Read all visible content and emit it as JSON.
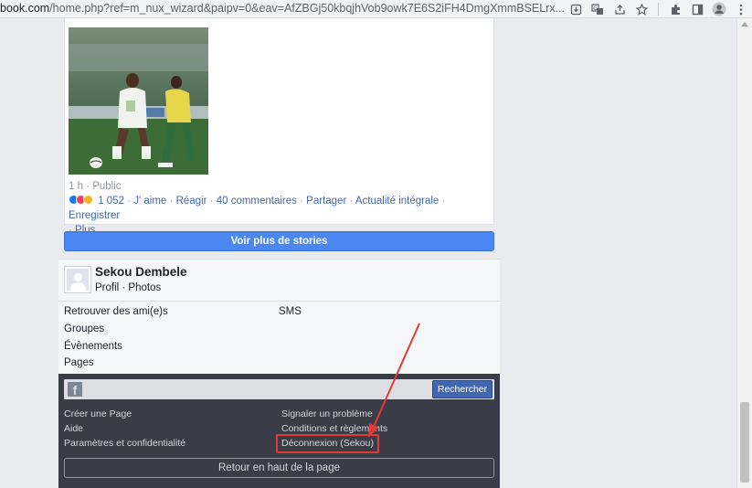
{
  "browser": {
    "url_host": "book.com",
    "url_rest": "/home.php?ref=m_nux_wizard&paipv=0&eav=AfZBGj50kbqjhVob9owk7E6S2iFH4DmgXmmBSELrx..."
  },
  "post": {
    "meta": "1 h · Public",
    "reaction_count": "1 052",
    "actions": [
      "J' aime",
      "Réagir",
      "40 commentaires",
      "Partager",
      "Actualité intégrale",
      "Enregistrer",
      "Plus"
    ]
  },
  "more_stories": "Voir plus de stories",
  "profile": {
    "name": "Sekou Dembele",
    "links": "Profil · Photos"
  },
  "links": {
    "friends": "Retrouver des ami(e)s",
    "sms": "SMS",
    "groups": "Groupes",
    "events": "Évènements",
    "pages": "Pages"
  },
  "footer": {
    "logo": "f",
    "search_button": "Rechercher",
    "create_page": "Créer une Page",
    "report": "Signaler un problème",
    "help": "Aide",
    "terms": "Conditions et règlements",
    "privacy": "Paramètres et confidentialité",
    "logout": "Déconnexion (Sekou)",
    "back_top": "Retour en haut de la page"
  },
  "colors": {
    "link": "#4267b2",
    "footer_bg": "#3a3d47",
    "button_blue": "#4b87f0",
    "highlight": "#e53935"
  }
}
